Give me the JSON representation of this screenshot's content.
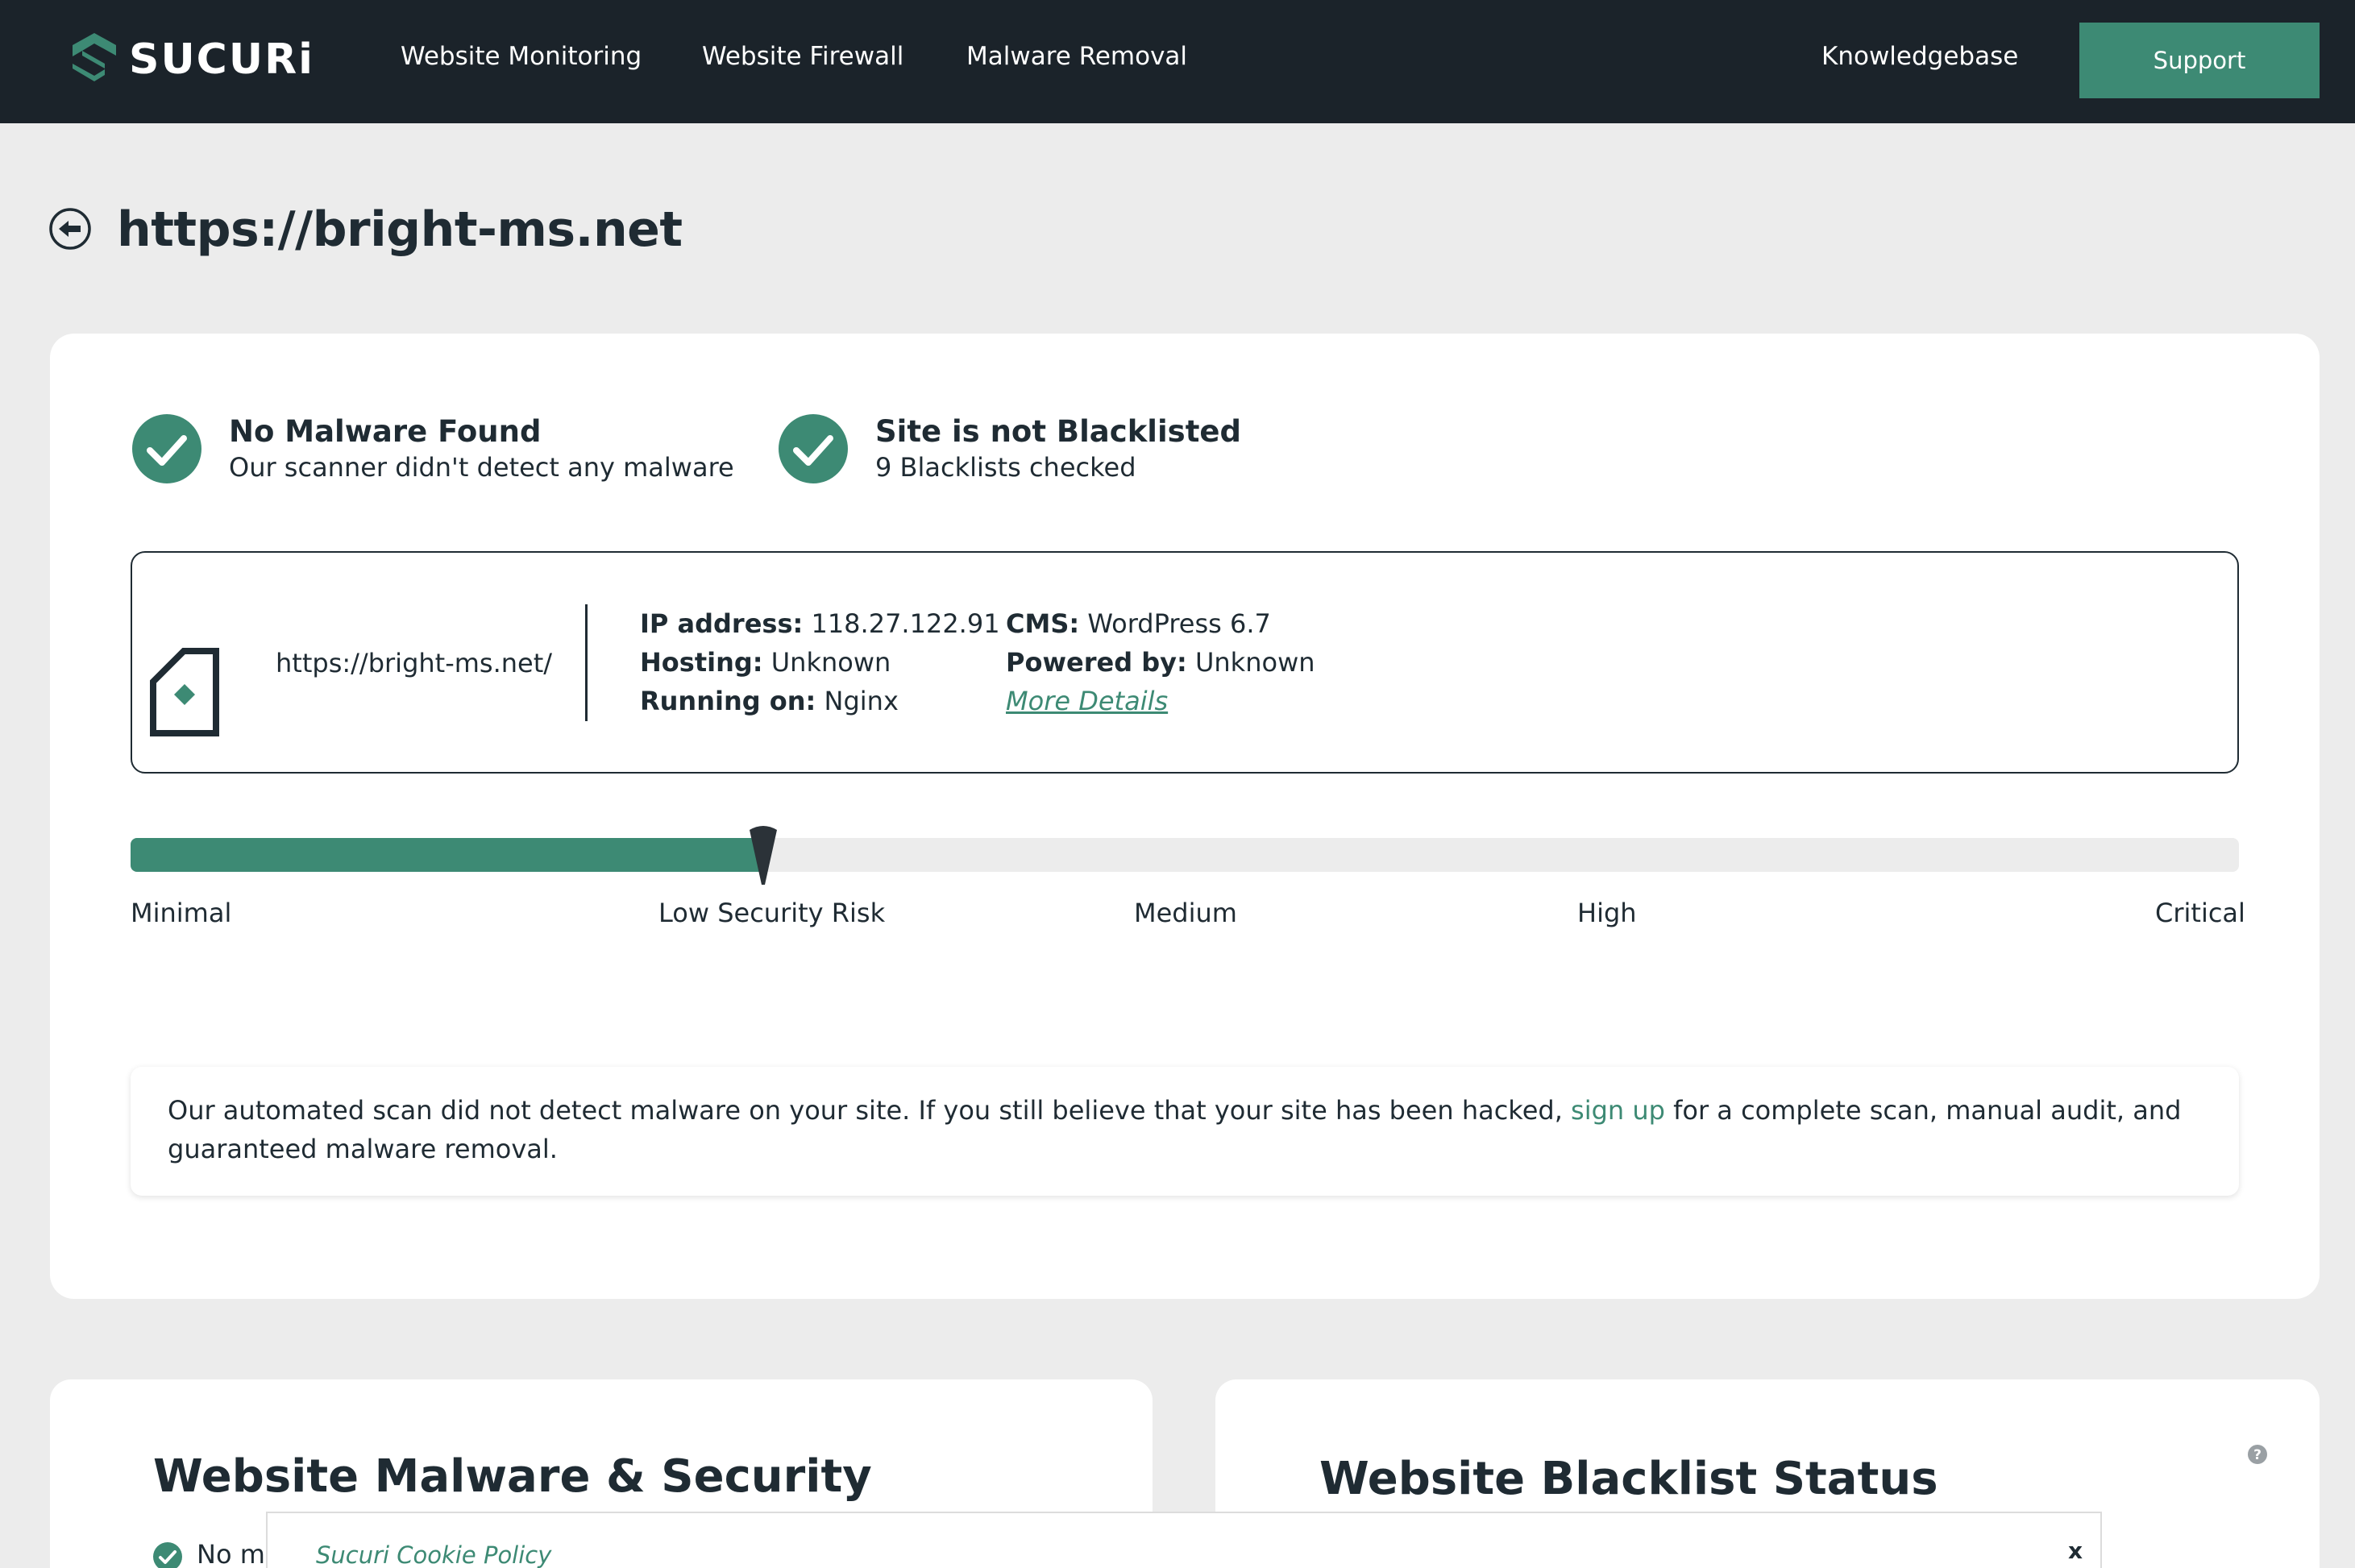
{
  "header": {
    "logo_text": "SUCURi",
    "nav": [
      "Website Monitoring",
      "Website Firewall",
      "Malware Removal"
    ],
    "knowledgebase": "Knowledgebase",
    "support": "Support"
  },
  "page": {
    "title": "https://bright-ms.net"
  },
  "status": {
    "malware_title": "No Malware Found",
    "malware_sub": "Our scanner didn't detect any malware",
    "blacklist_title": "Site is not Blacklisted",
    "blacklist_sub": "9 Blacklists checked"
  },
  "site_info": {
    "url": "https://bright-ms.net/",
    "ip_label": "IP address:",
    "ip_value": " 118.27.122.91",
    "hosting_label": "Hosting:",
    "hosting_value": " Unknown",
    "running_label": "Running on:",
    "running_value": " Nginx",
    "cms_label": "CMS:",
    "cms_value": " WordPress 6.7",
    "powered_label": "Powered by:",
    "powered_value": " Unknown",
    "more_details": "More Details"
  },
  "risk": {
    "level_fraction": 0.3,
    "labels": [
      "Minimal",
      "Low Security Risk",
      "Medium",
      "High",
      "Critical"
    ]
  },
  "notice": {
    "text_before": "Our automated scan did not detect malware on your site. If you still believe that your site has been hacked, ",
    "link": "sign up",
    "text_after": " for a complete scan, manual audit, and guaranteed malware removal."
  },
  "lower": {
    "malware_title": "Website Malware & Security",
    "malware_first_item": "No m",
    "blacklist_title": "Website Blacklist Status"
  },
  "cookie": {
    "title": "Sucuri Cookie Policy",
    "close": "x"
  },
  "colors": {
    "header_bg": "#1b232a",
    "accent": "#3d8a74",
    "page_bg": "#ececec",
    "text": "#1f2b33"
  }
}
